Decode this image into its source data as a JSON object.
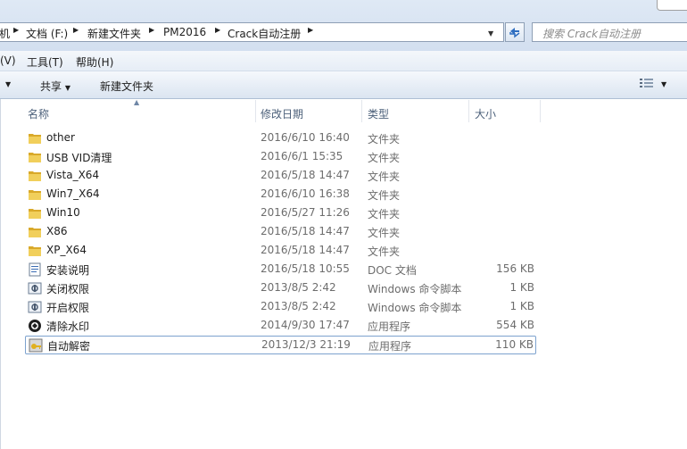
{
  "address": {
    "crumbs": [
      "机",
      "文档 (F:)",
      "新建文件夹",
      "PM2016",
      "Crack自动注册"
    ],
    "search_placeholder": "搜索 Crack自动注册"
  },
  "menu": {
    "items": [
      "(V)",
      "工具(T)",
      "帮助(H)"
    ]
  },
  "toolbar": {
    "share": "共享",
    "new_folder": "新建文件夹"
  },
  "columns": [
    "名称",
    "修改日期",
    "类型",
    "大小"
  ],
  "files": [
    {
      "name": "other",
      "date": "2016/6/10 16:40",
      "type": "文件夹",
      "size": "",
      "icon": "folder-icon"
    },
    {
      "name": "USB VID清理",
      "date": "2016/6/1 15:35",
      "type": "文件夹",
      "size": "",
      "icon": "folder-icon"
    },
    {
      "name": "Vista_X64",
      "date": "2016/5/18 14:47",
      "type": "文件夹",
      "size": "",
      "icon": "folder-icon"
    },
    {
      "name": "Win7_X64",
      "date": "2016/6/10 16:38",
      "type": "文件夹",
      "size": "",
      "icon": "folder-icon"
    },
    {
      "name": "Win10",
      "date": "2016/5/27 11:26",
      "type": "文件夹",
      "size": "",
      "icon": "folder-icon"
    },
    {
      "name": "X86",
      "date": "2016/5/18 14:47",
      "type": "文件夹",
      "size": "",
      "icon": "folder-icon"
    },
    {
      "name": "XP_X64",
      "date": "2016/5/18 14:47",
      "type": "文件夹",
      "size": "",
      "icon": "folder-icon"
    },
    {
      "name": "安装说明",
      "date": "2016/5/18 10:55",
      "type": "DOC 文档",
      "size": "156 KB",
      "icon": "document-icon"
    },
    {
      "name": "关闭权限",
      "date": "2013/8/5 2:42",
      "type": "Windows 命令脚本",
      "size": "1 KB",
      "icon": "script-icon"
    },
    {
      "name": "开启权限",
      "date": "2013/8/5 2:42",
      "type": "Windows 命令脚本",
      "size": "1 KB",
      "icon": "script-icon"
    },
    {
      "name": "清除水印",
      "date": "2014/9/30 17:47",
      "type": "应用程序",
      "size": "554 KB",
      "icon": "app-icon"
    },
    {
      "name": "自动解密",
      "date": "2013/12/3 21:19",
      "type": "应用程序",
      "size": "110 KB",
      "icon": "app-key-icon",
      "selected": true
    }
  ],
  "colors": {
    "selection_border": "#7da2ce",
    "folder": "#e8c04a"
  }
}
